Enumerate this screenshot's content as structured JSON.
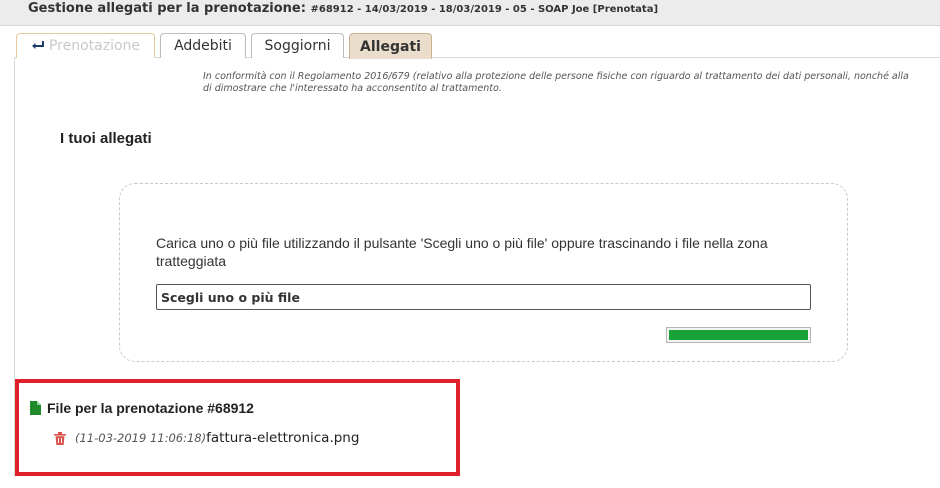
{
  "window": {
    "title": "Gestione allegati per la prenotazione:",
    "subtitle": "#68912 - 14/03/2019 - 18/03/2019 - 05 - SOAP Joe [Prenotata]"
  },
  "tabs": [
    {
      "label": "Prenotazione",
      "icon": "return-arrow-icon",
      "state": "disabled"
    },
    {
      "label": "Addebiti",
      "state": "normal"
    },
    {
      "label": "Soggiorni",
      "state": "normal"
    },
    {
      "label": "Allegati",
      "state": "active"
    }
  ],
  "notice": {
    "line1": "In conformità con il Regolamento 2016/679 (relativo alla protezione delle persone fisiche con riguardo al trattamento dei dati personali, nonché alla",
    "line2": "di dimostrare che l'interessato ha acconsentito al trattamento."
  },
  "attachments": {
    "section_title": "I tuoi allegati",
    "dropzone": {
      "instructions": "Carica uno o più file utilizzando il pulsante 'Scegli uno o più file' oppure trascinando i file nella zona tratteggiata",
      "button_label": "Scegli uno o più file",
      "progress": 1.0
    }
  },
  "files": {
    "header": "File per la prenotazione #68912",
    "header_icon": "document-icon",
    "items": [
      {
        "date": "(11-03-2019 11:06:18)",
        "name": "fattura-elettronica.png",
        "delete_icon": "trash-icon"
      }
    ]
  },
  "colors": {
    "accent_tab": "#eaddcc",
    "progress": "#17a335",
    "highlight": "#e0202a",
    "document_icon": "#1e8a2a",
    "trash_icon": "#d9534f"
  }
}
